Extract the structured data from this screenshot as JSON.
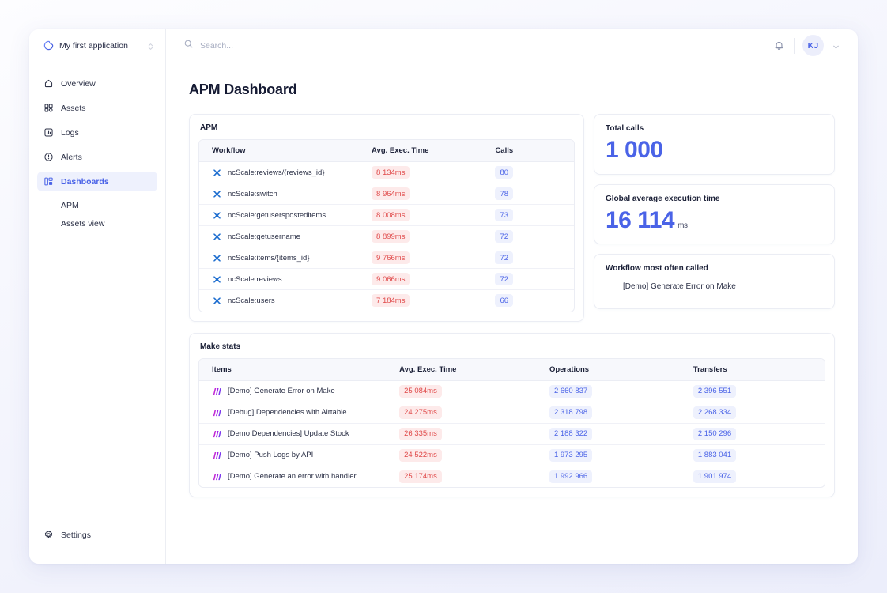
{
  "app": {
    "name": "My first application",
    "logo_icon": "ncscale-swirl-logo",
    "switcher_icon": "chevrons-up-down-icon"
  },
  "sidebar": {
    "items": [
      {
        "label": "Overview",
        "icon": "home-icon",
        "active": false
      },
      {
        "label": "Assets",
        "icon": "grid-icon",
        "active": false
      },
      {
        "label": "Logs",
        "icon": "bar-chart-box-icon",
        "active": false
      },
      {
        "label": "Alerts",
        "icon": "alert-circle-icon",
        "active": false
      },
      {
        "label": "Dashboards",
        "icon": "dashboard-icon",
        "active": true
      }
    ],
    "sub_items": [
      {
        "label": "APM"
      },
      {
        "label": "Assets view"
      }
    ],
    "bottom": {
      "label": "Settings",
      "icon": "gear-icon"
    }
  },
  "topbar": {
    "search": {
      "placeholder": "Search...",
      "value": "",
      "icon": "search-icon"
    },
    "notifications_icon": "bell-icon",
    "avatar_initials": "KJ",
    "caret_icon": "chevron-down-icon"
  },
  "page": {
    "title": "APM Dashboard"
  },
  "apm_table": {
    "title": "APM",
    "columns": [
      "Workflow",
      "Avg. Exec. Time",
      "Calls"
    ],
    "row_icon": "ncscale-x-icon",
    "rows": [
      {
        "workflow": "ncScale:reviews/{reviews_id}",
        "time": "8 134ms",
        "calls": "80"
      },
      {
        "workflow": "ncScale:switch",
        "time": "8 964ms",
        "calls": "78"
      },
      {
        "workflow": "ncScale:getusersposteditems",
        "time": "8 008ms",
        "calls": "73"
      },
      {
        "workflow": "ncScale:getusername",
        "time": "8 899ms",
        "calls": "72"
      },
      {
        "workflow": "ncScale:items/{items_id}",
        "time": "9 766ms",
        "calls": "72"
      },
      {
        "workflow": "ncScale:reviews",
        "time": "9 066ms",
        "calls": "72"
      },
      {
        "workflow": "ncScale:users",
        "time": "7 184ms",
        "calls": "66"
      }
    ]
  },
  "stats": [
    {
      "label": "Total calls",
      "value": "1 000",
      "unit": ""
    },
    {
      "label": "Global average execution time",
      "value": "16 114",
      "unit": "ms"
    },
    {
      "label": "Workflow most often called",
      "sub_value": "[Demo] Generate Error on Make"
    }
  ],
  "make_table": {
    "title": "Make stats",
    "columns": [
      "Items",
      "Avg. Exec. Time",
      "Operations",
      "Transfers"
    ],
    "row_icon": "make-logo-icon",
    "rows": [
      {
        "item": "[Demo] Generate Error on Make",
        "time": "25 084ms",
        "operations": "2 660 837",
        "transfers": "2 396 551"
      },
      {
        "item": "[Debug] Dependencies with Airtable",
        "time": "24 275ms",
        "operations": "2 318 798",
        "transfers": "2 268 334"
      },
      {
        "item": "[Demo Dependencies] Update Stock",
        "time": "26 335ms",
        "operations": "2 188 322",
        "transfers": "2 150 296"
      },
      {
        "item": "[Demo] Push Logs by API",
        "time": "24 522ms",
        "operations": "1 973 295",
        "transfers": "1 883 041"
      },
      {
        "item": "[Demo] Generate an error with handler",
        "time": "25 174ms",
        "operations": "1 992 966",
        "transfers": "1 901 974"
      }
    ]
  },
  "colors": {
    "accent": "#4a63e7",
    "accent_soft_bg": "#eef1fd",
    "error_text": "#e04a4a",
    "error_soft_bg": "#fdeaea",
    "make_purple": "#a020d8",
    "ncscale_blue": "#1f6fd0",
    "text_dark": "#1c2138",
    "border": "#ebedf4",
    "header_bg": "#f7f8fc"
  }
}
